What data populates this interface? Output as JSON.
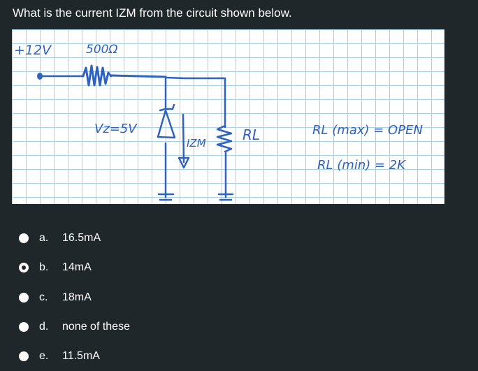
{
  "question": {
    "text": "What is the current IZM from the circuit shown below."
  },
  "figure": {
    "labels": {
      "source": "+12V",
      "resistor": "500Ω",
      "zener_voltage": "Vz=5V",
      "zener_current": "IZM",
      "load": "RL",
      "rl_max": "RL (max) = OPEN",
      "rl_min": "RL (min) = 2K"
    },
    "ink_color": "#2e62c0",
    "grid_color": "#a9d3e8"
  },
  "options": [
    {
      "letter": "a.",
      "text": "16.5mA",
      "selected": false
    },
    {
      "letter": "b.",
      "text": "14mA",
      "selected": true
    },
    {
      "letter": "c.",
      "text": "18mA",
      "selected": false
    },
    {
      "letter": "d.",
      "text": "none of these",
      "selected": false
    },
    {
      "letter": "e.",
      "text": "11.5mA",
      "selected": false
    }
  ]
}
